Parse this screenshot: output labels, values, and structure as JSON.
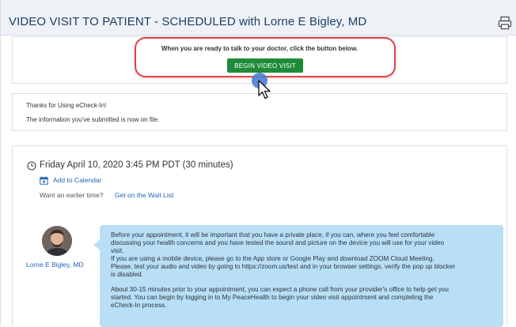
{
  "header": {
    "title": "VIDEO VISIT TO PATIENT - SCHEDULED with Lorne E Bigley, MD",
    "print_icon": "printer-icon"
  },
  "begin_card": {
    "instruction": "When you are ready to talk to your doctor, click the button below.",
    "button_label": "BEGIN VIDEO VISIT",
    "button_color": "#1f8a3a",
    "highlight_color": "#d9474c"
  },
  "thanks_card": {
    "line1": "Thanks for Using eCheck-In!",
    "line2": "The information you've submitted is now on file."
  },
  "appointment": {
    "clock_icon": "clock-icon",
    "datetime": "Friday April 10, 2020 3:45 PM PDT (30 minutes)",
    "calendar_icon": "calendar-icon",
    "add_to_calendar": "Add to Calendar",
    "earlier_prompt": "Want an earlier time?",
    "wait_list_link": "Get on the Wait List",
    "doctor_name": "Lorne E Bigley, MD",
    "message": [
      "Before your appointment, it will be important that you have a private place, if you can, where you feel comfortable",
      "discussing your health concerns and you have tested the sound and picture on the device you will use for your video",
      "visit.",
      "If you are using a mobile device, please go to the App store or Google Play and download ZOOM Cloud Meeting.",
      "Please, test your audio and video by going to https://zoom.us/test and in your browser settings, verify the pop up blocker",
      "is disabled.",
      "",
      "About 30-15 minutes prior to your appointment, you can expect a phone call from your provider's office to help get you",
      "started. You can begin by logging in to My PeaceHealth to begin your video visit appointment and completing the",
      "eCheck-In process."
    ],
    "bubble_color": "#b8dff5",
    "link_color": "#2466b5"
  },
  "cursor_icon": "mouse-pointer-icon"
}
